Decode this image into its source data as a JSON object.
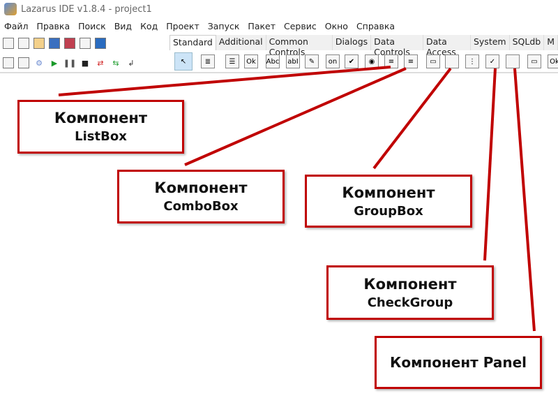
{
  "window": {
    "title": "Lazarus IDE v1.8.4 - project1"
  },
  "menu": [
    "Файл",
    "Правка",
    "Поиск",
    "Вид",
    "Код",
    "Проект",
    "Запуск",
    "Пакет",
    "Сервис",
    "Окно",
    "Справка"
  ],
  "palette_tabs": [
    "Standard",
    "Additional",
    "Common Controls",
    "Dialogs",
    "Data Controls",
    "Data Access",
    "System",
    "SQLdb",
    "M"
  ],
  "active_tab": "Standard",
  "palette_icons": [
    {
      "name": "pointer",
      "glyph": "↖"
    },
    {
      "name": "main-menu",
      "glyph": "≣"
    },
    {
      "name": "popup-menu",
      "glyph": "☰"
    },
    {
      "name": "button",
      "glyph": "Ok"
    },
    {
      "name": "label",
      "glyph": "Abc"
    },
    {
      "name": "edit",
      "glyph": "abI"
    },
    {
      "name": "memo",
      "glyph": "✎"
    },
    {
      "name": "toggle-box",
      "glyph": "on"
    },
    {
      "name": "checkbox",
      "glyph": "✔"
    },
    {
      "name": "radio-button",
      "glyph": "◉"
    },
    {
      "name": "listbox",
      "glyph": "≡"
    },
    {
      "name": "combobox",
      "glyph": "≡"
    },
    {
      "name": "scrollbar",
      "glyph": "▭"
    },
    {
      "name": "groupbox",
      "glyph": ""
    },
    {
      "name": "radiogroup",
      "glyph": "⋮"
    },
    {
      "name": "checkgroup",
      "glyph": "✓"
    },
    {
      "name": "panel",
      "glyph": ""
    },
    {
      "name": "frame",
      "glyph": "▭"
    },
    {
      "name": "action-list",
      "glyph": "Ok"
    }
  ],
  "callouts": [
    {
      "line1": "Компонент",
      "line2": "ListBox"
    },
    {
      "line1": "Компонент",
      "line2": "ComboBox"
    },
    {
      "line1": "Компонент",
      "line2": "GroupBox"
    },
    {
      "line1": "Компонент",
      "line2": "CheckGroup"
    },
    {
      "line1": "Компонент Panel",
      "line2": ""
    }
  ],
  "colors": {
    "callout_border": "#c00000",
    "pointer_line": "#c00000"
  }
}
